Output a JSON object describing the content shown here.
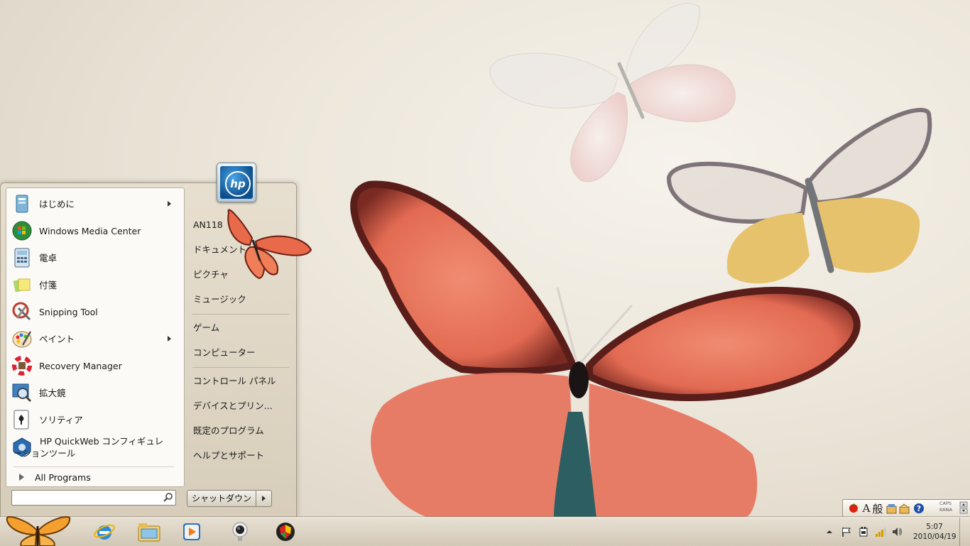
{
  "colors": {
    "accent": "#1b66a8",
    "menu_bg": "#e6decf",
    "left_pane_bg": "#fbfaf7",
    "butterfly_main": "#e8765e",
    "butterfly_yellow": "#e9be5c"
  },
  "start_menu": {
    "user_picture_icon": "hp-logo-icon",
    "user_picture_text": "hp",
    "pinned_programs": [
      {
        "label": "はじめに",
        "icon": "getting-started-icon",
        "has_submenu": true
      },
      {
        "label": "Windows Media Center",
        "icon": "media-center-icon",
        "has_submenu": false
      },
      {
        "label": "電卓",
        "icon": "calculator-icon",
        "has_submenu": false
      },
      {
        "label": "付箋",
        "icon": "sticky-notes-icon",
        "has_submenu": false
      },
      {
        "label": "Snipping Tool",
        "icon": "snipping-tool-icon",
        "has_submenu": false
      },
      {
        "label": "ペイント",
        "icon": "paint-icon",
        "has_submenu": true
      },
      {
        "label": "Recovery Manager",
        "icon": "recovery-manager-icon",
        "has_submenu": false
      },
      {
        "label": "拡大鏡",
        "icon": "magnifier-icon",
        "has_submenu": false
      },
      {
        "label": "ソリティア",
        "icon": "solitaire-icon",
        "has_submenu": false
      },
      {
        "label": "HP QuickWeb コンフィギュレーションツール",
        "line1": "HP QuickWeb コンフィギュレ",
        "line2": "ーションツール",
        "icon": "hp-quickweb-icon",
        "has_submenu": false
      }
    ],
    "all_programs": "All Programs",
    "search_placeholder": "",
    "right_items": [
      "AN118",
      "ドキュメント",
      "ピクチャ",
      "ミュージック",
      "ゲーム",
      "コンピューター",
      "コントロール パネル",
      "デバイスとプリン...",
      "既定のプログラム",
      "ヘルプとサポート"
    ],
    "shutdown_label": "シャットダウン"
  },
  "taskbar": {
    "start_button": "start-orb-butterfly-icon",
    "pinned": [
      "internet-explorer-icon",
      "windows-explorer-icon",
      "media-player-icon",
      "webcam-icon",
      "security-shield-icon"
    ],
    "tray_icons": [
      "show-hidden-icons-chevron",
      "action-center-flag-icon",
      "power-icon",
      "network-signal-icon",
      "volume-icon"
    ],
    "time": "5:07",
    "date": "2010/04/19"
  },
  "language_bar": {
    "items": [
      "ime-icon",
      "input-mode-A",
      "general-mode-般",
      "ime-pad-icon",
      "ime-tools-icon",
      "help-icon"
    ],
    "input_mode": "A",
    "conversion_mode": "般",
    "help": "?",
    "caps": "CAPS",
    "kana": "KANA"
  }
}
